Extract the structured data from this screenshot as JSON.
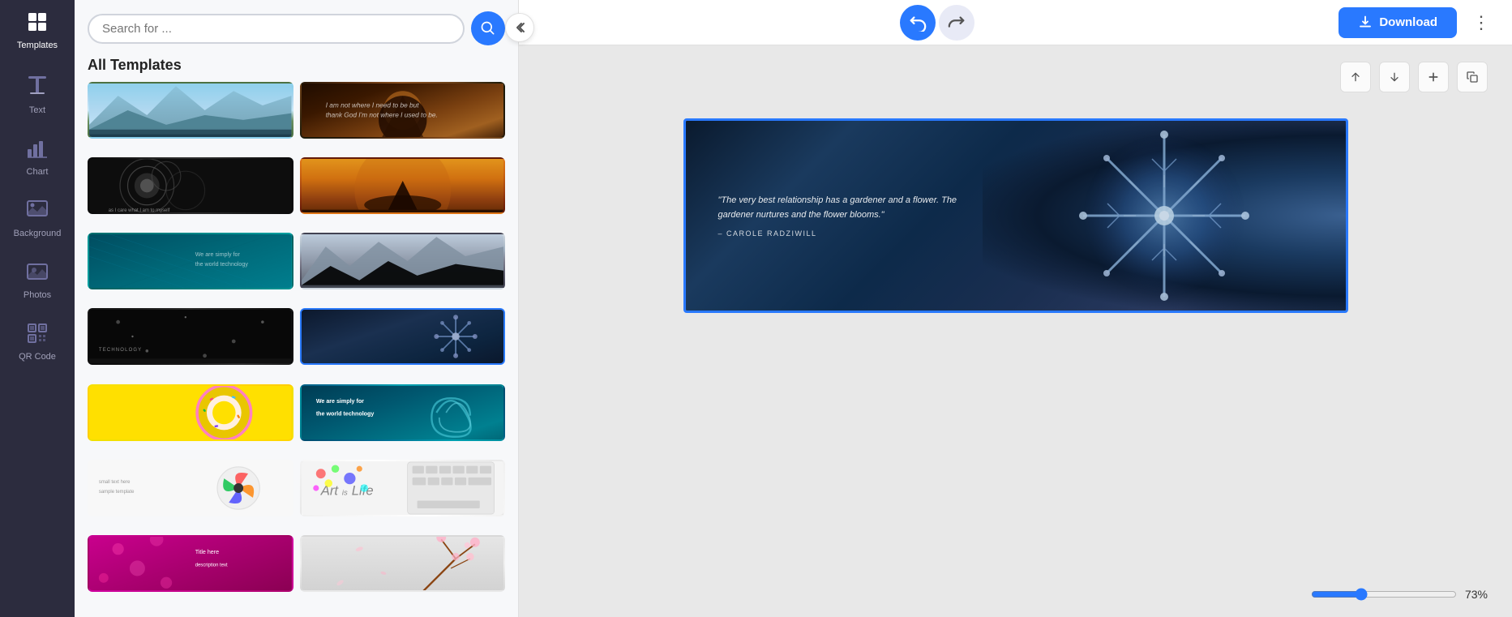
{
  "sidebar": {
    "items": [
      {
        "id": "templates",
        "label": "Templates",
        "icon": "⊞",
        "active": true
      },
      {
        "id": "text",
        "label": "Text",
        "icon": "T"
      },
      {
        "id": "chart",
        "label": "Chart",
        "icon": "📊"
      },
      {
        "id": "background",
        "label": "Background",
        "icon": "🖼"
      },
      {
        "id": "photos",
        "label": "Photos",
        "icon": "🖼"
      },
      {
        "id": "qrcode",
        "label": "QR Code",
        "icon": "⊟"
      }
    ]
  },
  "panel": {
    "search_placeholder": "Search for ...",
    "section_title": "All Templates",
    "templates": [
      {
        "id": 1,
        "style": "t-nature-mountains",
        "selected": false
      },
      {
        "id": 2,
        "style": "t-autumn-forest",
        "selected": false
      },
      {
        "id": 3,
        "style": "t-dark-circles",
        "selected": false
      },
      {
        "id": 4,
        "style": "t-desert-sunset",
        "selected": false
      },
      {
        "id": 5,
        "style": "t-teal-fabric",
        "selected": false
      },
      {
        "id": 6,
        "style": "t-rocky-mountains",
        "selected": false
      },
      {
        "id": 7,
        "style": "t-dark-sparkle",
        "selected": false
      },
      {
        "id": 8,
        "style": "t-snowflake",
        "selected": true
      },
      {
        "id": 9,
        "style": "t-yellow-donut",
        "selected": false
      },
      {
        "id": 10,
        "style": "t-teal-swirl",
        "selected": false
      },
      {
        "id": 11,
        "style": "t-white-colorful",
        "selected": false
      },
      {
        "id": 12,
        "style": "t-art-life",
        "selected": false
      },
      {
        "id": 13,
        "style": "t-pink-floral",
        "selected": false
      },
      {
        "id": 14,
        "style": "t-cherry-blossom",
        "selected": false
      }
    ]
  },
  "toolbar": {
    "undo_label": "↺",
    "redo_label": "↻",
    "download_label": "Download",
    "more_label": "⋮"
  },
  "canvas": {
    "controls": {
      "move_up": "↑",
      "move_down": "↓",
      "add": "+",
      "duplicate": "⧉"
    },
    "quote": {
      "main": "\"The very best relationship has a gardener and a flower. The gardener nurtures and the flower blooms.\"",
      "author": "– CAROLE RADZIWILL"
    }
  },
  "zoom": {
    "value": 73,
    "label": "73%",
    "min": 10,
    "max": 200
  }
}
